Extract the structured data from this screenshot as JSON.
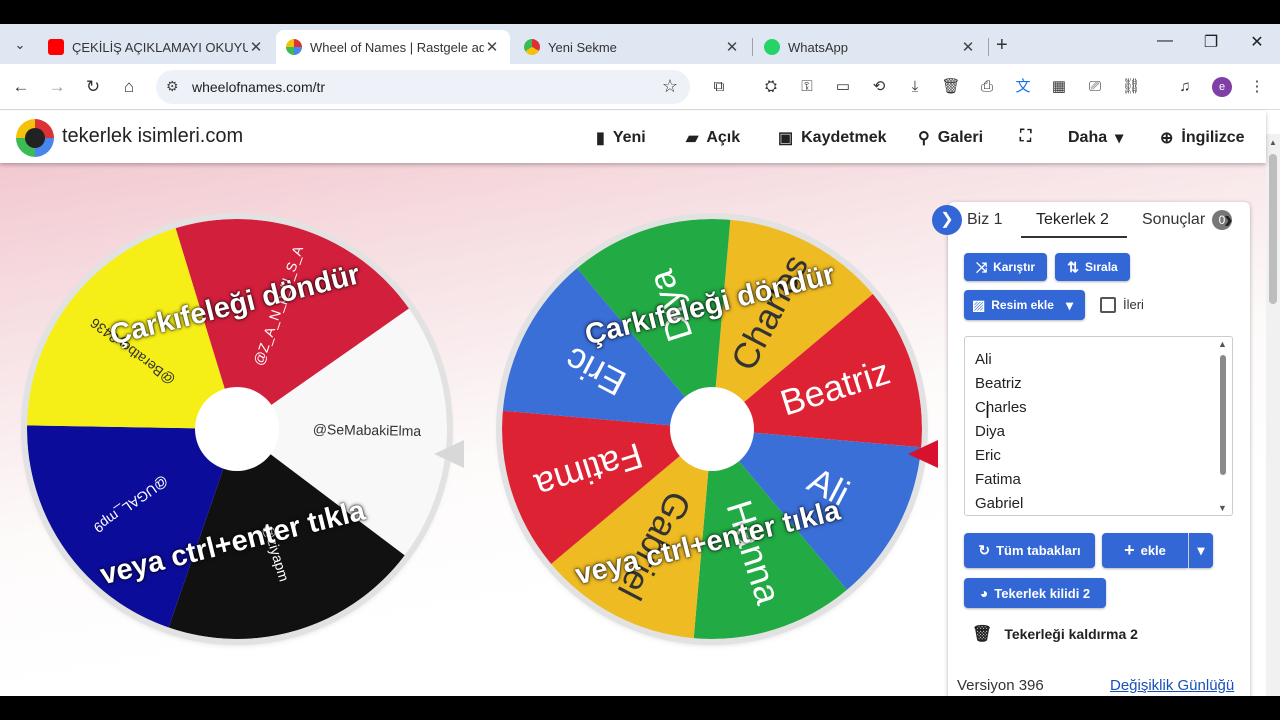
{
  "browser": {
    "tabs": [
      {
        "title": "ÇEKİLİŞ AÇIKLAMAYI OKUYUN",
        "active": false,
        "favicon": "youtube-icon"
      },
      {
        "title": "Wheel of Names | Rastgele ad se",
        "active": true,
        "favicon": "wheel-icon"
      },
      {
        "title": "Yeni Sekme",
        "active": false,
        "favicon": "chrome-icon"
      },
      {
        "title": "WhatsApp",
        "active": false,
        "favicon": "whatsapp-icon"
      }
    ],
    "url": "wheelofnames.com/tr",
    "profile_initial": "e"
  },
  "site": {
    "name": "tekerlek isimleri.com",
    "menu": {
      "new": "Yeni",
      "open": "Açık",
      "save": "Kaydetmek",
      "gallery": "Galeri",
      "more": "Daha",
      "language": "İngilizce"
    }
  },
  "wheels": {
    "spin_text_top": "Çarkıfeleği döndür",
    "spin_text_bottom": "veya ctrl+enter tıkla",
    "wheel1": {
      "segments": [
        {
          "label": "@Z_A_N_p_U_S_A",
          "color": "#d21f3c"
        },
        {
          "label": "@SeMabakiElma",
          "color": "#f8f8f8"
        },
        {
          "label": "@ziyapm",
          "color": "#111111"
        },
        {
          "label": "@UGAL_mp9",
          "color": "#0c0c9a"
        },
        {
          "label": "@Beratbey3436",
          "color": "#f6ef17"
        }
      ]
    },
    "wheel2": {
      "segments": [
        {
          "label": "Charles",
          "color": "#eebb22"
        },
        {
          "label": "Beatriz",
          "color": "#dd2233"
        },
        {
          "label": "Ali",
          "color": "#3a6fd8"
        },
        {
          "label": "Hanna",
          "color": "#22aa44"
        },
        {
          "label": "Gabriel",
          "color": "#eebb22"
        },
        {
          "label": "Fatima",
          "color": "#dd2233"
        },
        {
          "label": "Eric",
          "color": "#3a6fd8"
        },
        {
          "label": "Diya",
          "color": "#22aa44"
        }
      ]
    }
  },
  "panel": {
    "tabs": [
      "Biz 1",
      "Tekerlek 2",
      "Sonuçlar"
    ],
    "results_count": "0",
    "shuffle": "Karıştır",
    "sort": "Sırala",
    "add_image": "Resim ekle",
    "advanced": "İleri",
    "names": [
      "Ali",
      "Beatriz",
      "Charles",
      "Diya",
      "Eric",
      "Fatima",
      "Gabriel"
    ],
    "all_wheels": "Tüm tabakları",
    "add": "ekle",
    "wheel_lock": "Tekerlek kilidi 2",
    "remove_wheel": "Tekerleği kaldırma 2",
    "version": "Versiyon 396",
    "changelog": "Değişiklik Günlüğü"
  }
}
